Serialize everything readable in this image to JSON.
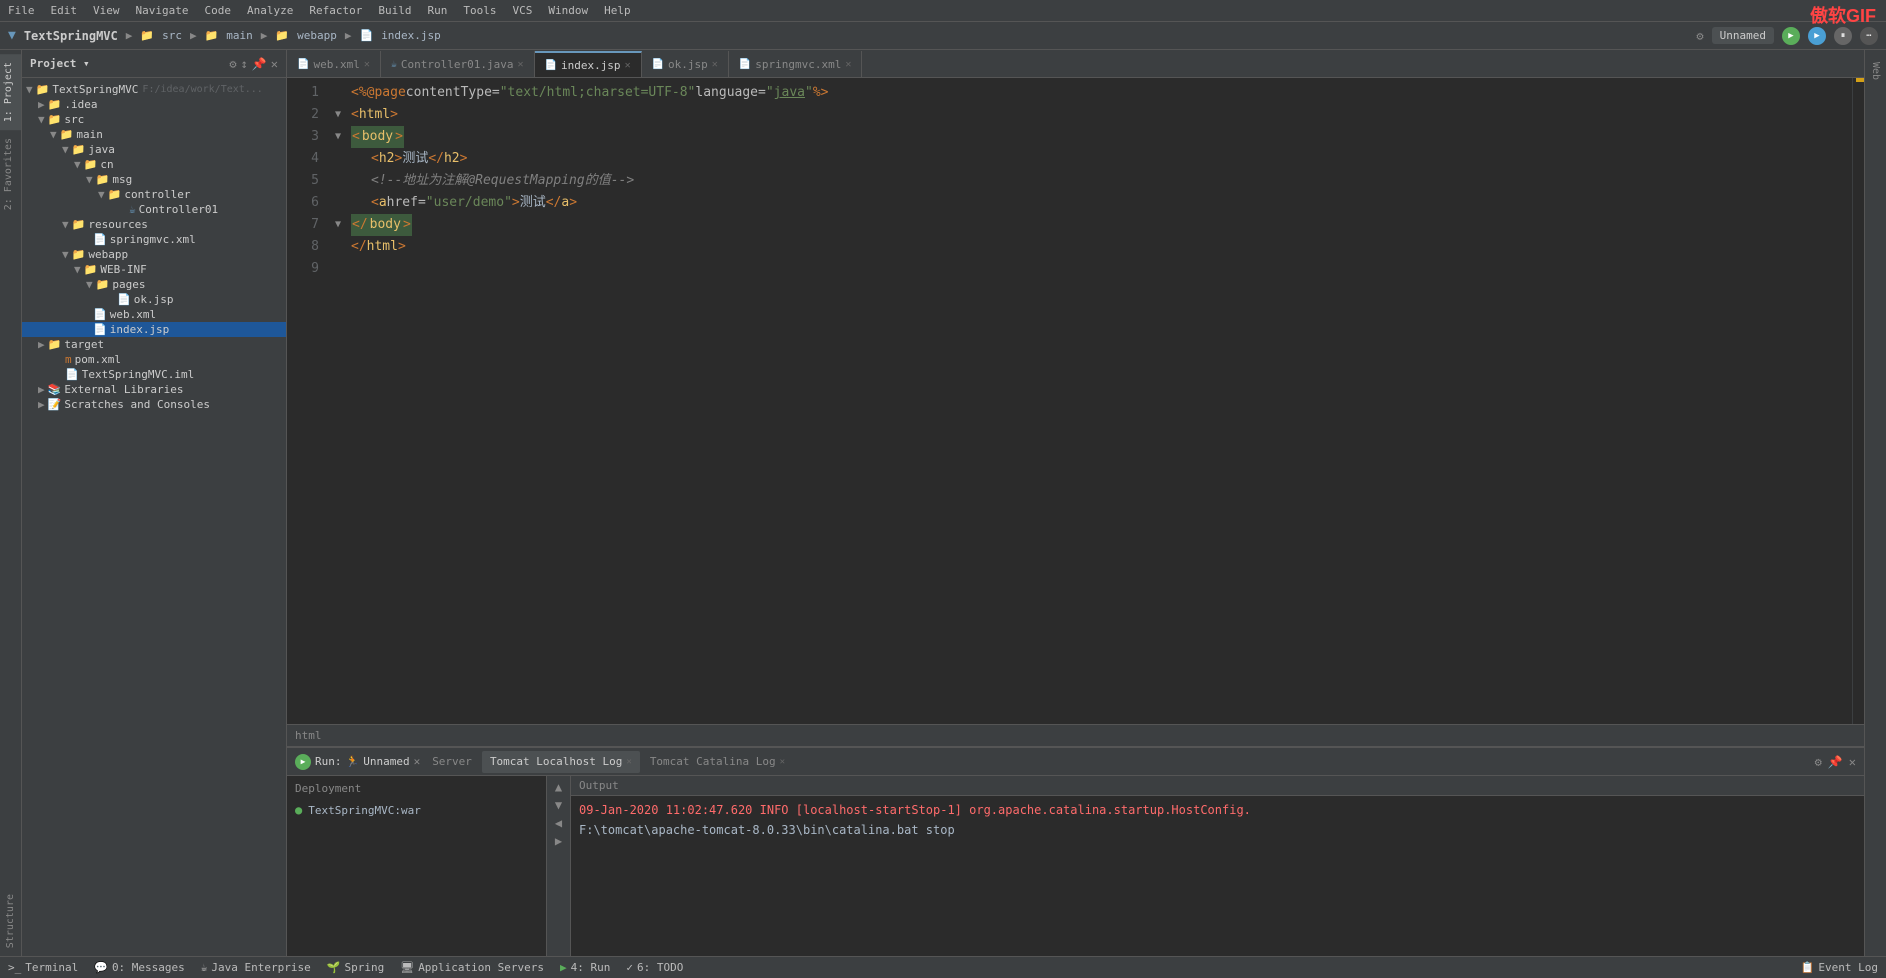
{
  "app": {
    "title": "TextSpringMVC",
    "brand": "傲软GIF"
  },
  "menu": {
    "items": [
      "File",
      "Edit",
      "View",
      "Navigate",
      "Code",
      "Analyze",
      "Refactor",
      "Build",
      "Run",
      "Tools",
      "VCS",
      "Window",
      "Help"
    ]
  },
  "titlebar": {
    "project": "TextSpringMVC",
    "path_src": "src",
    "path_main": "main",
    "path_webapp": "webapp",
    "path_file": "index.jsp",
    "run_config": "Unnamed",
    "run_label": "▶",
    "debug_label": "🐛",
    "more_label": "⏸"
  },
  "tabs": [
    {
      "label": "web.xml",
      "icon": "📄",
      "active": false
    },
    {
      "label": "Controller01.java",
      "icon": "☕",
      "active": false
    },
    {
      "label": "index.jsp",
      "icon": "📄",
      "active": true
    },
    {
      "label": "ok.jsp",
      "icon": "📄",
      "active": false
    },
    {
      "label": "springmvc.xml",
      "icon": "📄",
      "active": false
    }
  ],
  "sidebar": {
    "title": "Project",
    "items": [
      {
        "level": 0,
        "type": "folder",
        "label": "TextSpringMVC",
        "path": "F:/idea/work/Text...",
        "expanded": true
      },
      {
        "level": 1,
        "type": "folder",
        "label": ".idea",
        "expanded": false
      },
      {
        "level": 1,
        "type": "folder",
        "label": "src",
        "expanded": true
      },
      {
        "level": 2,
        "type": "folder",
        "label": "main",
        "expanded": true
      },
      {
        "level": 3,
        "type": "folder",
        "label": "java",
        "expanded": true
      },
      {
        "level": 4,
        "type": "folder",
        "label": "cn",
        "expanded": true
      },
      {
        "level": 5,
        "type": "folder",
        "label": "msg",
        "expanded": true
      },
      {
        "level": 6,
        "type": "folder",
        "label": "controller",
        "expanded": true
      },
      {
        "level": 7,
        "type": "java",
        "label": "Controller01",
        "expanded": false
      },
      {
        "level": 3,
        "type": "folder",
        "label": "resources",
        "expanded": true
      },
      {
        "level": 4,
        "type": "xml",
        "label": "springmvc.xml",
        "expanded": false
      },
      {
        "level": 3,
        "type": "folder",
        "label": "webapp",
        "expanded": true
      },
      {
        "level": 4,
        "type": "folder",
        "label": "WEB-INF",
        "expanded": true
      },
      {
        "level": 5,
        "type": "folder",
        "label": "pages",
        "expanded": true
      },
      {
        "level": 6,
        "type": "jsp",
        "label": "ok.jsp",
        "expanded": false
      },
      {
        "level": 4,
        "type": "xml",
        "label": "web.xml",
        "expanded": false
      },
      {
        "level": 4,
        "type": "jsp",
        "label": "index.jsp",
        "expanded": false,
        "selected": true
      },
      {
        "level": 1,
        "type": "folder",
        "label": "target",
        "expanded": false
      },
      {
        "level": 1,
        "type": "xml",
        "label": "pom.xml",
        "expanded": false
      },
      {
        "level": 1,
        "type": "file",
        "label": "TextSpringMVC.iml",
        "expanded": false
      }
    ]
  },
  "external_libraries": "External Libraries",
  "scratches": "Scratches and Consoles",
  "code": {
    "lines": [
      {
        "num": 1,
        "content": "<%@ page contentType=\"text/html;charset=UTF-8\" language=\"java\" %>",
        "type": "jsp"
      },
      {
        "num": 2,
        "content": "    <html>",
        "type": "html"
      },
      {
        "num": 3,
        "content": "    <body>",
        "type": "html-body"
      },
      {
        "num": 4,
        "content": "        <h2>测试</h2>",
        "type": "html"
      },
      {
        "num": 5,
        "content": "        <!--地址为注解@RequestMapping的值-->",
        "type": "comment"
      },
      {
        "num": 6,
        "content": "        <a href=\"user/demo\">测试</a>",
        "type": "html"
      },
      {
        "num": 7,
        "content": "    </body>",
        "type": "html-body"
      },
      {
        "num": 8,
        "content": "    </html>",
        "type": "html"
      },
      {
        "num": 9,
        "content": "",
        "type": "empty"
      }
    ],
    "status": "html"
  },
  "bottom_panel": {
    "run_label": "Run:",
    "config_name": "Unnamed",
    "tabs": [
      {
        "label": "Server",
        "active": false
      },
      {
        "label": "Tomcat Localhost Log",
        "active": false
      },
      {
        "label": "Tomcat Catalina Log",
        "active": true
      }
    ],
    "sections": {
      "deployment_header": "Deployment",
      "output_header": "Output",
      "deploy_item": "TextSpringMVC:war"
    },
    "logs": [
      {
        "text": "09-Jan-2020 11:02:47.620 INFO [localhost-startStop-1] org.apache.catalina.startup.HostConfig.",
        "type": "info"
      },
      {
        "text": "F:\\tomcat\\apache-tomcat-8.0.33\\bin\\catalina.bat stop",
        "type": "command"
      }
    ]
  },
  "status_bar": {
    "items": [
      {
        "label": "Terminal",
        "icon": ">_"
      },
      {
        "label": "0: Messages",
        "icon": "💬"
      },
      {
        "label": "Java Enterprise",
        "icon": "☕"
      },
      {
        "label": "Spring",
        "icon": "🌱"
      },
      {
        "label": "Application Servers",
        "icon": "🖥"
      },
      {
        "label": "4: Run",
        "icon": "▶"
      },
      {
        "label": "6: TODO",
        "icon": "✓"
      },
      {
        "label": "Event Log",
        "icon": "📋"
      }
    ]
  },
  "side_tabs": [
    {
      "label": "1: Project"
    },
    {
      "label": "2: Favorites"
    },
    {
      "label": "Structure"
    }
  ],
  "right_side_tabs": [
    {
      "label": "Web"
    }
  ]
}
